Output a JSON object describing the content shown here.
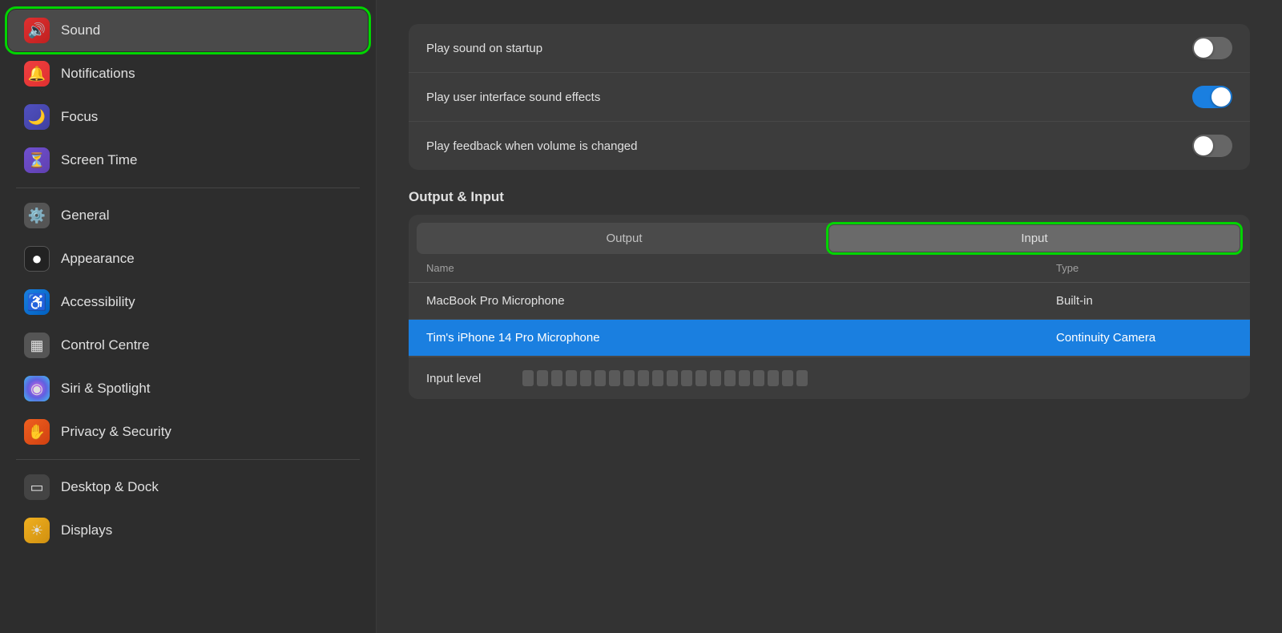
{
  "sidebar": {
    "items": [
      {
        "id": "notifications",
        "label": "Notifications",
        "icon": "🔔",
        "iconClass": "icon-notifications",
        "active": false
      },
      {
        "id": "sound",
        "label": "Sound",
        "icon": "🔊",
        "iconClass": "icon-sound",
        "active": true
      },
      {
        "id": "focus",
        "label": "Focus",
        "icon": "🌙",
        "iconClass": "icon-focus",
        "active": false
      },
      {
        "id": "screentime",
        "label": "Screen Time",
        "icon": "⏳",
        "iconClass": "icon-screentime",
        "active": false
      }
    ],
    "items2": [
      {
        "id": "general",
        "label": "General",
        "icon": "⚙️",
        "iconClass": "icon-general",
        "active": false
      },
      {
        "id": "appearance",
        "label": "Appearance",
        "icon": "●",
        "iconClass": "icon-appearance",
        "active": false
      },
      {
        "id": "accessibility",
        "label": "Accessibility",
        "icon": "♿",
        "iconClass": "icon-accessibility",
        "active": false
      },
      {
        "id": "controlcentre",
        "label": "Control Centre",
        "icon": "▦",
        "iconClass": "icon-controlcentre",
        "active": false
      },
      {
        "id": "siri",
        "label": "Siri & Spotlight",
        "icon": "◉",
        "iconClass": "icon-siri",
        "active": false
      },
      {
        "id": "privacy",
        "label": "Privacy & Security",
        "icon": "✋",
        "iconClass": "icon-privacy",
        "active": false
      }
    ],
    "items3": [
      {
        "id": "desktop",
        "label": "Desktop & Dock",
        "icon": "▭",
        "iconClass": "icon-desktop",
        "active": false
      },
      {
        "id": "displays",
        "label": "Displays",
        "icon": "☀",
        "iconClass": "icon-displays",
        "active": false
      }
    ]
  },
  "main": {
    "sound_settings": [
      {
        "id": "play-startup",
        "label": "Play sound on startup",
        "state": "off"
      },
      {
        "id": "play-ui-sounds",
        "label": "Play user interface sound effects",
        "state": "on"
      },
      {
        "id": "play-feedback",
        "label": "Play feedback when volume is changed",
        "state": "off"
      }
    ],
    "output_input_heading": "Output & Input",
    "tabs": [
      {
        "id": "output",
        "label": "Output",
        "active": false
      },
      {
        "id": "input",
        "label": "Input",
        "active": true
      }
    ],
    "table_headers": [
      {
        "id": "name",
        "label": "Name"
      },
      {
        "id": "type",
        "label": "Type"
      }
    ],
    "table_rows": [
      {
        "id": "macbook-mic",
        "name": "MacBook Pro Microphone",
        "type": "Built-in",
        "selected": false
      },
      {
        "id": "iphone-mic",
        "name": "Tim's iPhone 14 Pro Microphone",
        "type": "Continuity Camera",
        "selected": true
      }
    ],
    "input_level_label": "Input level",
    "level_bars_count": 20
  }
}
